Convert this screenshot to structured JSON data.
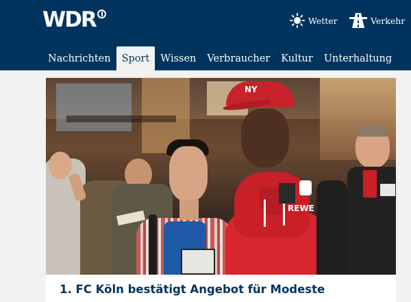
{
  "header": {
    "logo_text": "WDR",
    "utilities": [
      {
        "label": "Wetter",
        "icon": "sun-icon"
      },
      {
        "label": "Verkehr",
        "icon": "road-icon"
      }
    ]
  },
  "nav": {
    "tabs": [
      {
        "label": "Nachrichten",
        "active": false
      },
      {
        "label": "Sport",
        "active": true
      },
      {
        "label": "Wissen",
        "active": false
      },
      {
        "label": "Verbraucher",
        "active": false
      },
      {
        "label": "Kultur",
        "active": false
      },
      {
        "label": "Unterhaltung",
        "active": false
      }
    ]
  },
  "teaser": {
    "headline": "1. FC Köln bestätigt Angebot für Modeste",
    "image": {
      "jersey_text": "REWE",
      "cap_text": "NY"
    }
  },
  "colors": {
    "brand": "#00345e",
    "tab_background": "#f2f2f2",
    "content_background": "#f2f2f2",
    "headline": "#00345e",
    "jersey": "#d8262e"
  }
}
